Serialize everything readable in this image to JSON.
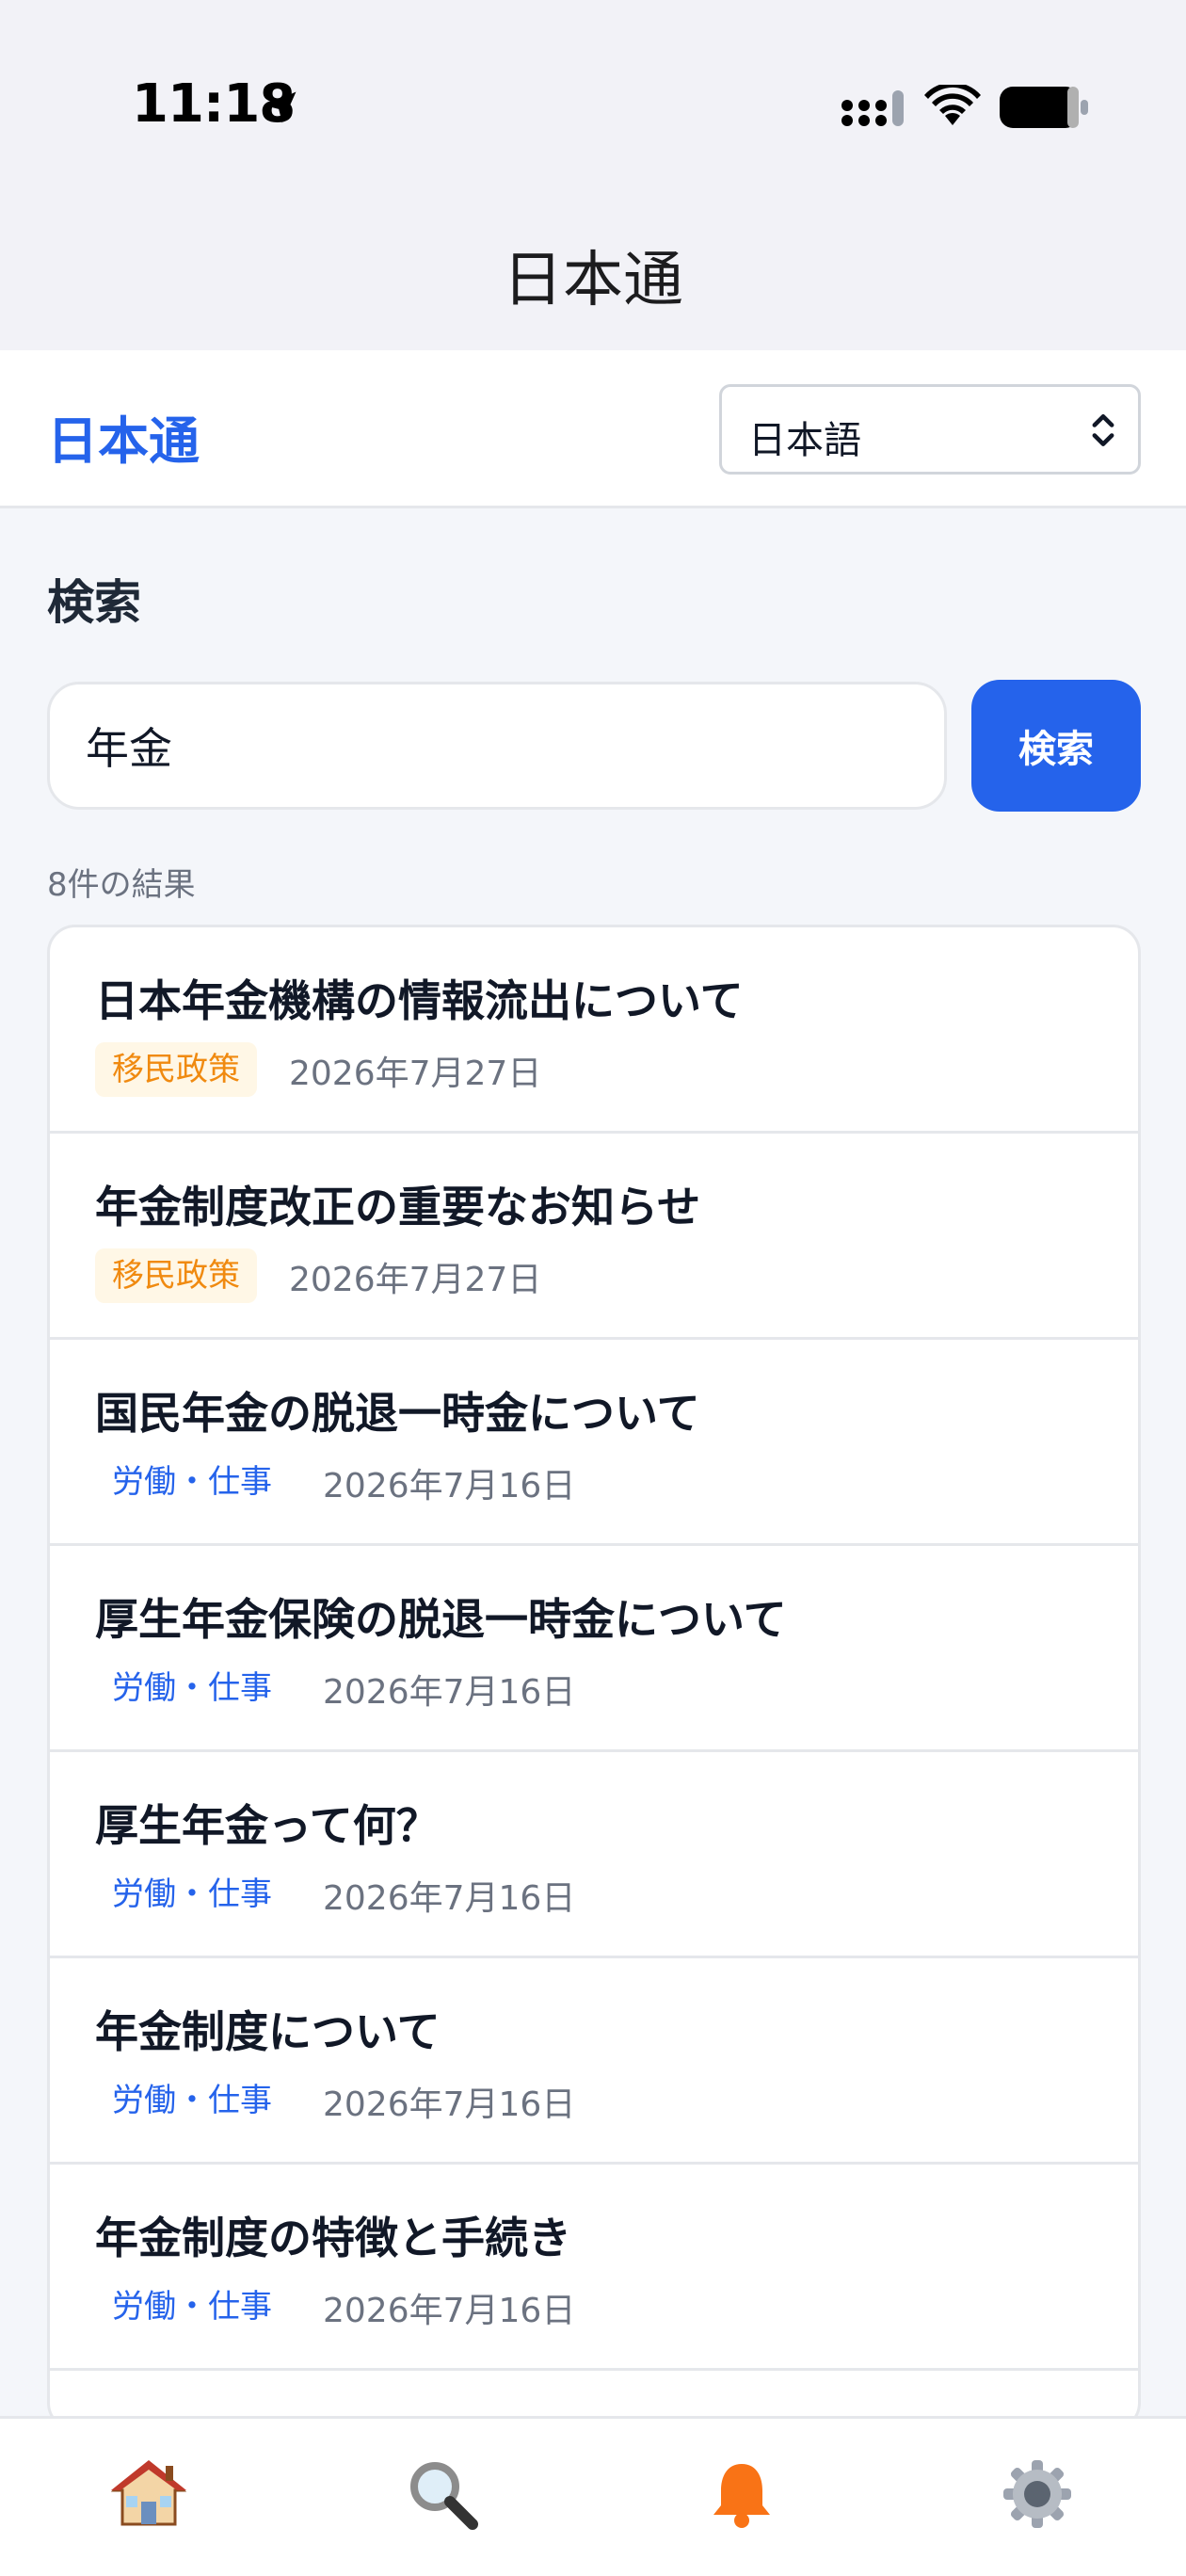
{
  "status": {
    "time": "11:18"
  },
  "nav": {
    "title": "日本通"
  },
  "header": {
    "brand": "日本通",
    "language": "日本語"
  },
  "search": {
    "section_title": "検索",
    "query": "年金",
    "button_label": "検索",
    "result_count": "8件の結果"
  },
  "results": [
    {
      "title": "日本年金機構の情報流出について",
      "tag": "移民政策",
      "tag_color": "orange",
      "date": "2026年7月27日"
    },
    {
      "title": "年金制度改正の重要なお知らせ",
      "tag": "移民政策",
      "tag_color": "orange",
      "date": "2026年7月27日"
    },
    {
      "title": "国民年金の脱退一時金について",
      "tag": "労働・仕事",
      "tag_color": "blue",
      "date": "2026年7月16日"
    },
    {
      "title": "厚生年金保険の脱退一時金について",
      "tag": "労働・仕事",
      "tag_color": "blue",
      "date": "2026年7月16日"
    },
    {
      "title": "厚生年金って何？",
      "tag": "労働・仕事",
      "tag_color": "blue",
      "date": "2026年7月16日"
    },
    {
      "title": "年金制度について",
      "tag": "労働・仕事",
      "tag_color": "blue",
      "date": "2026年7月16日"
    },
    {
      "title": "年金制度の特徴と手続き",
      "tag": "労働・仕事",
      "tag_color": "blue",
      "date": "2026年7月16日"
    }
  ],
  "tabs": [
    {
      "icon": "home-icon"
    },
    {
      "icon": "search-icon"
    },
    {
      "icon": "bell-icon",
      "active": true
    },
    {
      "icon": "gear-icon"
    }
  ],
  "colors": {
    "accent": "#2563eb",
    "tag_orange": "#f08a10",
    "tag_orange_bg": "#fff7e6"
  }
}
